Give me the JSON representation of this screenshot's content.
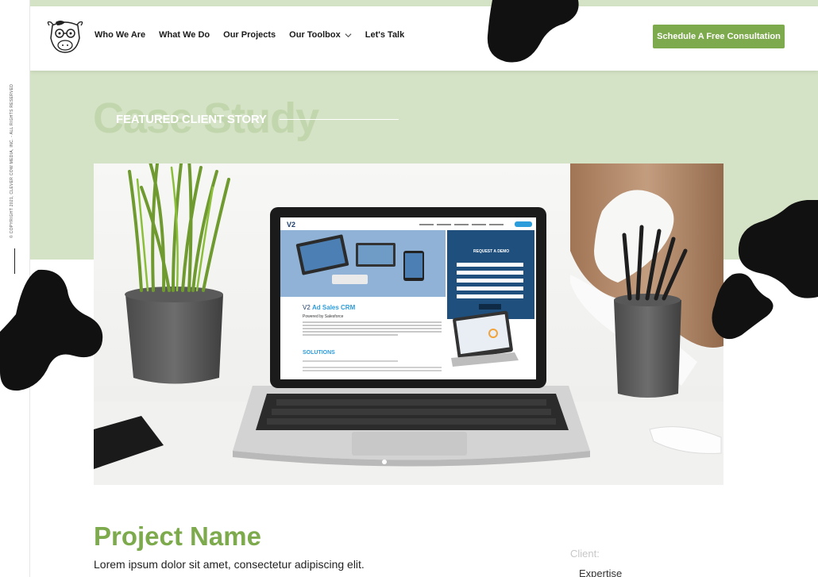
{
  "rail": {
    "copyright": "© COPYRIGHT 2021, CLEVER COW MEDIA, INC. - ALL RIGHTS RESERVED"
  },
  "nav": {
    "items": [
      "Who We Are",
      "What We Do",
      "Our Projects",
      "Our Toolbox",
      "Let's Talk"
    ],
    "cta": "Schedule A Free Consultation"
  },
  "hero": {
    "ghost_title": "Case Study",
    "eyebrow": "FEATURED CLIENT STORY"
  },
  "screen": {
    "logo": "V2",
    "headline_a": "V2 ",
    "headline_b": "Ad Sales CRM",
    "subhead": "Powered by Salesforce",
    "form_title": "REQUEST A DEMO",
    "solutions": "SOLUTIONS"
  },
  "project": {
    "name": "Project Name",
    "description": "Lorem ipsum dolor sit amet, consectetur adipiscing elit.",
    "client_label": "Client:",
    "expertise_label": "Expertise"
  },
  "colors": {
    "accent": "#7daa4d",
    "band": "#d4e2c5",
    "spot": "#111111"
  }
}
